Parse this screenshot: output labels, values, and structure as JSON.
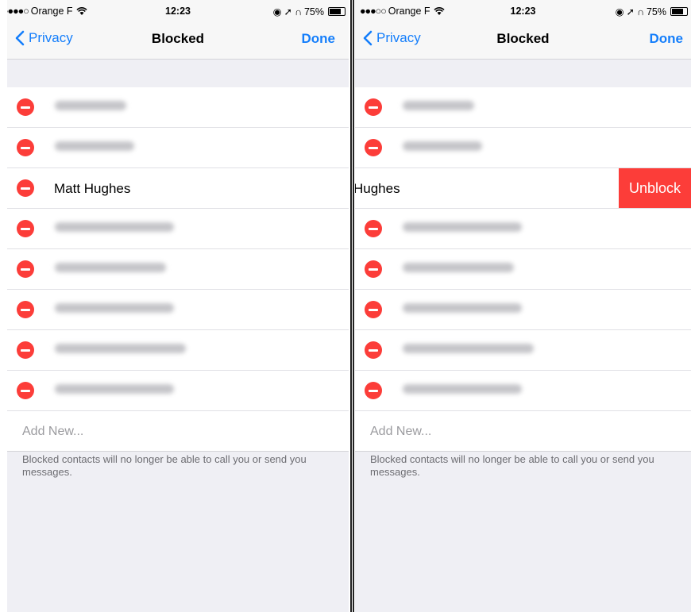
{
  "colors": {
    "accent": "#147efb",
    "destructive": "#fc3d39",
    "background": "#efeff4"
  },
  "status_bar": {
    "dots": "●●●●○",
    "carrier": "Orange F",
    "time": "12:23",
    "battery": "75%"
  },
  "left_screen": {
    "status_dots": "●●●●○",
    "nav": {
      "back_label": "Privacy",
      "title": "Blocked",
      "done_label": "Done"
    },
    "visible_contact": "Matt Hughes",
    "add_new": "Add New...",
    "footer": "Blocked contacts will no longer be able to call you or send you messages."
  },
  "right_screen": {
    "status_dots": "●●●○○",
    "nav": {
      "back_label": "Privacy",
      "title": "Blocked",
      "done_label": "Done"
    },
    "visible_contact": "Hughes",
    "unblock_label": "Unblock",
    "add_new": "Add New...",
    "footer": "Blocked contacts will no longer be able to call you or send you messages."
  }
}
